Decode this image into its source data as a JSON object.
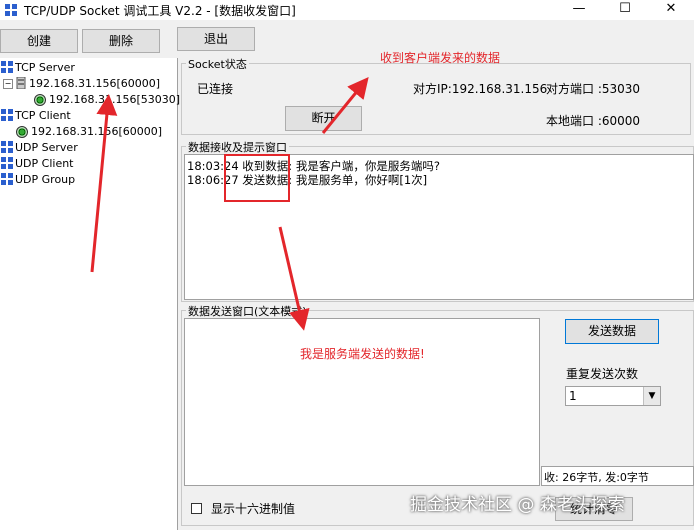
{
  "window": {
    "title": "TCP/UDP Socket 调试工具 V2.2 - [数据收发窗口]",
    "controls": {
      "minimize": "—",
      "maximize": "☐",
      "close": "✕"
    }
  },
  "toolbar": {
    "create": "创建",
    "delete": "删除",
    "exit": "退出"
  },
  "tree": {
    "tcp_server": "TCP Server",
    "tcp_server_child": "192.168.31.156[60000]",
    "tcp_server_conn": "192.168.31.156[53030]",
    "tcp_client": "TCP Client",
    "tcp_client_child": "192.168.31.156[60000]",
    "udp_server": "UDP Server",
    "udp_client": "UDP Client",
    "udp_group": "UDP Group"
  },
  "socket": {
    "group_label": "Socket状态",
    "status": "已连接",
    "peer_ip": "对方IP:192.168.31.156",
    "peer_port": "对方端口 :53030",
    "local_port": "本地端口 :60000",
    "disconnect": "断开"
  },
  "recv": {
    "group_label": "数据接收及提示窗口",
    "lines": [
      "18:03:24 收到数据: 我是客户端，你是服务端吗?",
      "18:06:27 发送数据: 我是服务单，你好啊[1次]"
    ]
  },
  "send": {
    "group_label": "数据发送窗口(文本模式)",
    "send_button": "发送数据",
    "repeat_label": "重复发送次数",
    "repeat_value": "1",
    "stats": "收: 26字节, 发:0字节",
    "hex_label": "显示十六进制值",
    "clear_stats": "统计清零"
  },
  "annotations": {
    "received_from_client": "收到客户端发来的数据",
    "sent_by_server": "我是服务端发送的数据!"
  },
  "watermark": "掘金技术社区 @ 森老头探索",
  "colors": {
    "annotation": "#e3262b",
    "window_bg": "#f0f0f0"
  }
}
